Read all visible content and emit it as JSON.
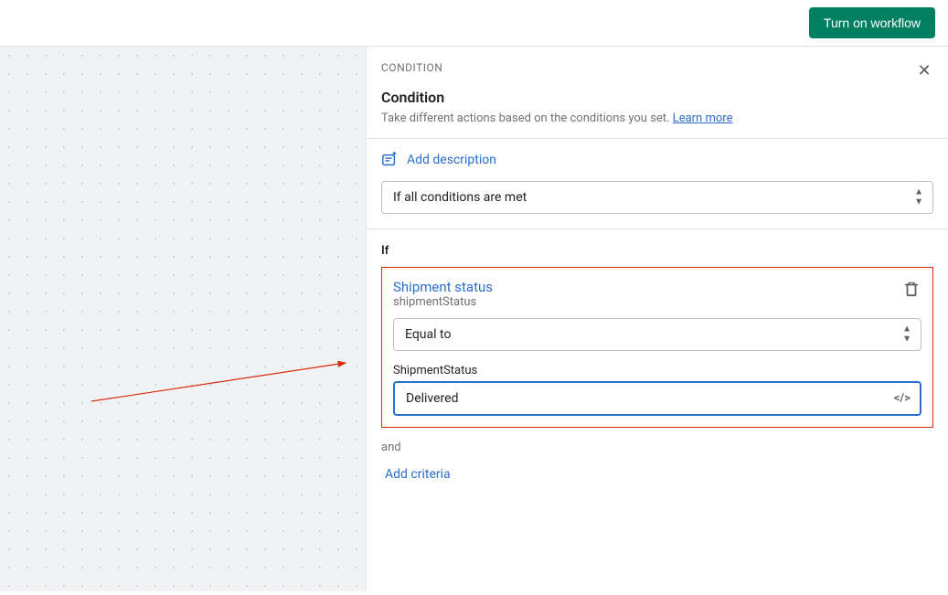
{
  "topbar": {
    "turn_on_label": "Turn on workflow"
  },
  "panel": {
    "eyebrow": "CONDITION",
    "title": "Condition",
    "subtitle_prefix": "Take different actions based on the conditions you set. ",
    "learn_more": "Learn more",
    "close_label": "Close",
    "add_description": "Add description",
    "condition_mode": "If all conditions are met",
    "if_label": "If",
    "criteria": {
      "title": "Shipment status",
      "subtitle": "shipmentStatus",
      "operator": "Equal to",
      "value_label": "ShipmentStatus",
      "value": "Delivered"
    },
    "and_label": "and",
    "add_criteria": "Add criteria"
  }
}
